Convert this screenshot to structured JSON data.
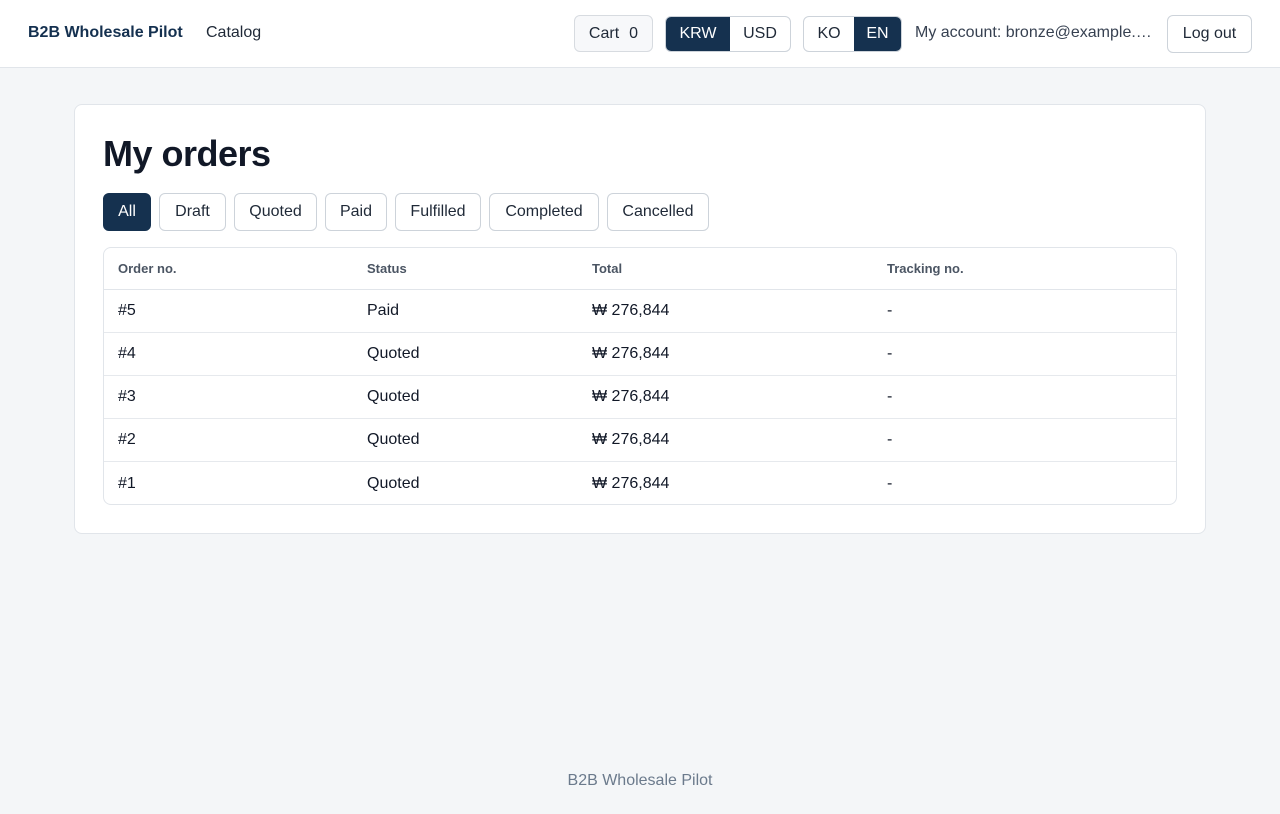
{
  "header": {
    "brand": "B2B Wholesale Pilot",
    "nav": {
      "catalog": "Catalog"
    },
    "cart": {
      "label": "Cart",
      "count": "0"
    },
    "currency": {
      "options": [
        "KRW",
        "USD"
      ],
      "selected": "KRW"
    },
    "language": {
      "options": [
        "KO",
        "EN"
      ],
      "selected": "EN"
    },
    "account": "My account: bronze@example.com",
    "logout": "Log out"
  },
  "main": {
    "title": "My orders",
    "filters": [
      "All",
      "Draft",
      "Quoted",
      "Paid",
      "Fulfilled",
      "Completed",
      "Cancelled"
    ],
    "active_filter": "All",
    "table": {
      "columns": [
        "Order no.",
        "Status",
        "Total",
        "Tracking no."
      ],
      "rows": [
        [
          "#5",
          "Paid",
          "₩ 276,844",
          "-"
        ],
        [
          "#4",
          "Quoted",
          "₩ 276,844",
          "-"
        ],
        [
          "#3",
          "Quoted",
          "₩ 276,844",
          "-"
        ],
        [
          "#2",
          "Quoted",
          "₩ 276,844",
          "-"
        ],
        [
          "#1",
          "Quoted",
          "₩ 276,844",
          "-"
        ]
      ]
    }
  },
  "footer": {
    "text": "B2B Wholesale Pilot"
  },
  "colors": {
    "primary": "#15314f",
    "background": "#f4f6f8",
    "border": "#e1e5ea"
  }
}
